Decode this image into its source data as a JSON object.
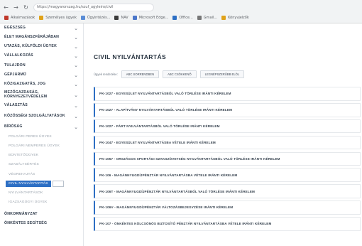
{
  "browser": {
    "back": "←",
    "forward": "→",
    "reload": "↻",
    "url": "https://magyarorszag.hu/szuf_ugyleiro/civil",
    "bookmarks": [
      {
        "label": "Alkalmazások",
        "color": "#c0392b"
      },
      {
        "label": "Személyes ügyek",
        "color": "#e0a21a"
      },
      {
        "label": "Ügyintézés...",
        "color": "#5a8dd6"
      },
      {
        "label": "NAV",
        "color": "#3b3b3b"
      },
      {
        "label": "Microsoft Edge...",
        "color": "#4a76c9"
      },
      {
        "label": "Office...",
        "color": "#2d6fc4"
      },
      {
        "label": "Gmail...",
        "color": "#777777"
      },
      {
        "label": "Könyvjelzők",
        "color": "#e0a21a"
      }
    ]
  },
  "sidebar": {
    "items": [
      {
        "label": "Egészség"
      },
      {
        "label": "Élet magánszférájában"
      },
      {
        "label": "Utazás, külföldi ügyek"
      },
      {
        "label": "Vállalkozás"
      },
      {
        "label": "Tulajdon"
      },
      {
        "label": "Gépjármű"
      },
      {
        "label": "Közigazgatás, jog"
      },
      {
        "label": "Mezőgazdaság, környezetvédelem"
      },
      {
        "label": "Választás"
      },
      {
        "label": "Közösségi szolgáltatások"
      },
      {
        "label": "Bíróság"
      }
    ],
    "subitems": [
      {
        "label": "Polgári peres ügyek"
      },
      {
        "label": "Polgári nemperes ügyek"
      },
      {
        "label": "Büntetőügyek"
      },
      {
        "label": "Szabálysértés"
      },
      {
        "label": "Végrehajtás"
      },
      {
        "label": "Civil nyilvántartás",
        "active": true
      },
      {
        "label": "Nyilvántartások"
      },
      {
        "label": "Igazságügyi ügyek"
      }
    ],
    "bottom_items": [
      {
        "label": "Önkormányzat"
      },
      {
        "label": "Önkéntes segítség"
      }
    ]
  },
  "main": {
    "title": "CIVIL NYILVÁNTARTÁS",
    "filter_label": "Ügyek rendezése:",
    "filters": [
      "ABC sorrendben",
      "ABC csökkenő",
      "Legnépszerűbb elöl"
    ],
    "rows": [
      "PK-1027 - Egyesület nyilvántartásból való törlése iránti kérelem",
      "PK-1027 - Alapítvány nyilvántartásból való törlése iránti kérelem",
      "PK-1027 - Párt nyilvántartásból való törlése iránti kérelem",
      "PK-1047 - Egyesület nyilvántartásba vétele iránti kérelem",
      "PK-1057 - Országos sportági szakszövetség nyilvántartásból való törlése iránti kérelem",
      "PK-106 - Magánnyugdíjpénztár nyilvántartásba vétele iránti kérelem",
      "PK-106T - Magánnyugdíjpénztár nyilvántartásból való törlése iránti kérelem",
      "PK-106V - Magánnyugdíjpénztár változásbejegyzése iránti kérelem",
      "PK-107 - Önkéntes kölcsönös biztosító pénztár nyilvántartásba vétele iránti kérelem"
    ]
  }
}
